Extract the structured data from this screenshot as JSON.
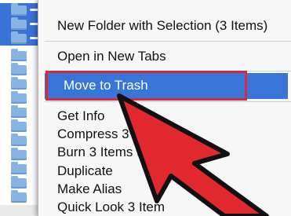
{
  "menu": {
    "items": [
      {
        "label": "New Folder with Selection (3 Items)"
      },
      {
        "label": "Open in New Tabs"
      },
      {
        "label": "Move to Trash"
      },
      {
        "label": "Get Info"
      },
      {
        "label": "Compress 3"
      },
      {
        "label": "Burn 3 Items t"
      },
      {
        "label": "Duplicate"
      },
      {
        "label": "Make Alias"
      },
      {
        "label": "Quick Look 3 Item"
      }
    ],
    "highlighted_index": 2
  },
  "colors": {
    "selection_blue": "#3775d8",
    "callout_red": "#d9293e",
    "arrow_red": "#e1282e"
  },
  "icons": [
    "folder-icon",
    "pointer-arrow-icon"
  ]
}
